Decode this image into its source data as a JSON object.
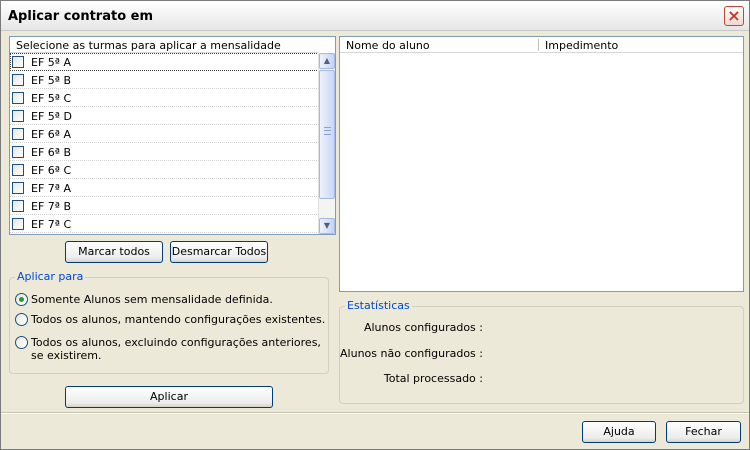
{
  "window": {
    "title": "Aplicar contrato em"
  },
  "left_list": {
    "header": "Selecione as turmas para aplicar a mensalidade",
    "items": [
      {
        "label": "EF 5ª A",
        "checked": false
      },
      {
        "label": "EF 5ª B",
        "checked": false
      },
      {
        "label": "EF 5ª C",
        "checked": false
      },
      {
        "label": "EF 5ª D",
        "checked": false
      },
      {
        "label": "EF 6ª A",
        "checked": false
      },
      {
        "label": "EF 6ª B",
        "checked": false
      },
      {
        "label": "EF 6ª C",
        "checked": false
      },
      {
        "label": "EF 7ª A",
        "checked": false
      },
      {
        "label": "EF 7ª B",
        "checked": false
      },
      {
        "label": "EF 7ª C",
        "checked": false
      }
    ]
  },
  "buttons": {
    "mark_all": "Marcar todos",
    "unmark_all": "Desmarcar Todos",
    "apply": "Aplicar",
    "help": "Ajuda",
    "close": "Fechar"
  },
  "apply_for": {
    "title": "Aplicar para",
    "options": [
      {
        "label": "Somente Alunos sem mensalidade definida.",
        "checked": true
      },
      {
        "label": "Todos os alunos, mantendo configurações existentes.",
        "checked": false
      },
      {
        "label_line1": "Todos os alunos, excluindo configurações anteriores,",
        "label_line2": "se existirem.",
        "checked": false
      }
    ]
  },
  "right_list": {
    "columns": [
      "Nome do aluno",
      "Impedimento"
    ]
  },
  "stats": {
    "title": "Estatísticas",
    "configured": "Alunos configurados :",
    "not_configured": "Alunos não configurados :",
    "total": "Total processado :"
  },
  "colors": {
    "accent": "#0046d5",
    "window_bg": "#ece9d8",
    "radio_checked": "#21a121"
  }
}
